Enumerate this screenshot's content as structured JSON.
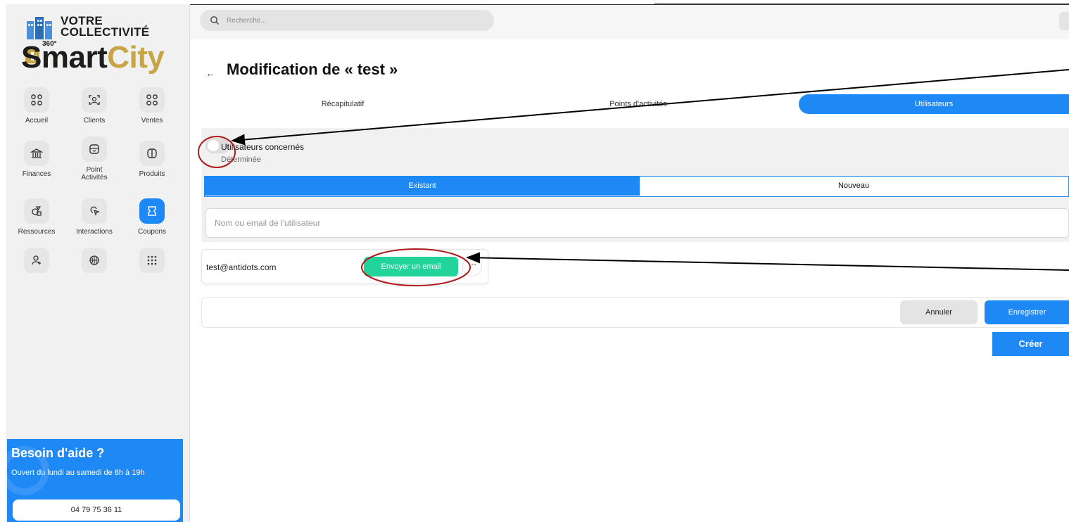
{
  "sidebar": {
    "logo": {
      "line1": "VOTRE",
      "line2": "COLLECTIVITÉ",
      "badge": "360°",
      "brand_a": "Smart",
      "brand_b": "City"
    },
    "nav": [
      {
        "label": "Accueil",
        "icon": "grid-icon"
      },
      {
        "label": "Clients",
        "icon": "face-scan-icon"
      },
      {
        "label": "Ventes",
        "icon": "grid-icon"
      },
      {
        "label": "Finances",
        "icon": "bank-icon"
      },
      {
        "label": "Point Activités",
        "icon": "store-icon"
      },
      {
        "label": "Produits",
        "icon": "book-icon"
      },
      {
        "label": "Ressources",
        "icon": "shapes-icon"
      },
      {
        "label": "Interactions",
        "icon": "cursor-click-icon"
      },
      {
        "label": "Coupons",
        "icon": "coupon-icon",
        "active": true
      },
      {
        "label": "",
        "icon": "user-add-icon"
      },
      {
        "label": "",
        "icon": "basketball-icon"
      },
      {
        "label": "",
        "icon": "dots-grid-icon"
      }
    ],
    "help": {
      "title": "Besoin d'aide ?",
      "text": "Ouvert du lundi au samedi de 8h à 19h",
      "phone": "04 79 75 36 11"
    }
  },
  "topbar": {
    "search_placeholder": "Recherche..."
  },
  "page": {
    "back_symbol": "←",
    "title": "Modification de « test »",
    "tabs": [
      {
        "label": "Récapitulatif",
        "active": false
      },
      {
        "label": "Points d'activités",
        "active": false
      },
      {
        "label": "Utilisateurs",
        "active": true
      }
    ]
  },
  "users_section": {
    "title": "Utilisateurs concernés",
    "subtitle": "Déterminée",
    "segment": [
      {
        "label": "Existant",
        "active": true
      },
      {
        "label": "Nouveau",
        "active": false
      }
    ],
    "search_placeholder": "Nom ou email de l'utilisateur",
    "user": {
      "email": "test@antidots.com",
      "send_label": "Envoyer un email",
      "more_symbol": "⋯"
    }
  },
  "actions": {
    "cancel_label": "Annuler",
    "save_label": "Enregistrer",
    "create_label": "Créer"
  },
  "colors": {
    "primary": "#1e88f5",
    "success": "#22d39a",
    "brand_gold": "#c8a445",
    "annotation": "#b11a1a"
  }
}
